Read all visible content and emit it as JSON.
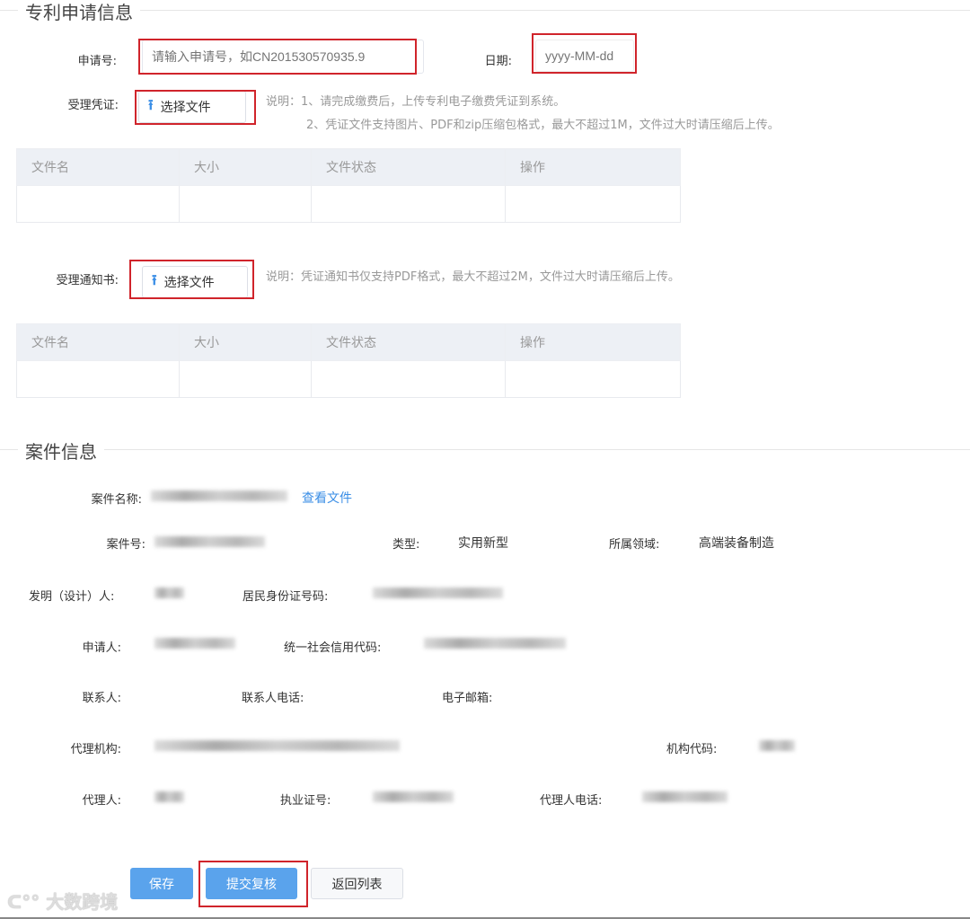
{
  "patent_section": {
    "title": "专利申请信息",
    "app_no_label": "申请号:",
    "app_no_placeholder": "请输入申请号，如CN201530570935.9",
    "date_label": "日期:",
    "date_placeholder": "yyyy-MM-dd",
    "voucher_label": "受理凭证:",
    "upload_label": "选择文件",
    "voucher_note_1": "说明：1、请完成缴费后，上传专利电子缴费凭证到系统。",
    "voucher_note_2": "2、凭证文件支持图片、PDF和zip压缩包格式，最大不超过1M，文件过大时请压缩后上传。",
    "notice_label": "受理通知书:",
    "notice_note": "说明：凭证通知书仅支持PDF格式，最大不超过2M，文件过大时请压缩后上传。",
    "table_headers": [
      "文件名",
      "大小",
      "文件状态",
      "操作"
    ]
  },
  "case_section": {
    "title": "案件信息",
    "case_name_label": "案件名称:",
    "view_file": "查看文件",
    "case_no_label": "案件号:",
    "type_label": "类型:",
    "type_value": "实用新型",
    "field_label": "所属领域:",
    "field_value": "高端装备制造",
    "inventor_label": "发明（设计）人:",
    "id_label": "居民身份证号码:",
    "applicant_label": "申请人:",
    "credit_label": "统一社会信用代码:",
    "contact_label": "联系人:",
    "contact_phone_label": "联系人电话:",
    "email_label": "电子邮箱:",
    "agency_label": "代理机构:",
    "agency_code_label": "机构代码:",
    "agent_label": "代理人:",
    "license_label": "执业证号:",
    "agent_phone_label": "代理人电话:"
  },
  "actions": {
    "save": "保存",
    "submit": "提交复核",
    "back": "返回列表"
  },
  "watermark": "大数跨境",
  "colors": {
    "primary": "#5aa3ec",
    "highlight": "#d0242b",
    "link": "#3a8ee6"
  }
}
